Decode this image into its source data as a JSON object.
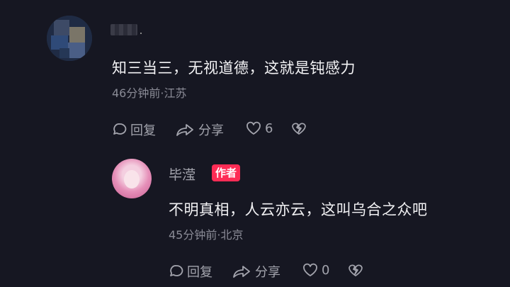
{
  "comment": {
    "text": "知三当三，无视道德，这就是钝感力",
    "meta": "46分钟前·江苏",
    "actions": {
      "reply_label": "回复",
      "share_label": "分享",
      "like_count": "6"
    }
  },
  "reply": {
    "username": "毕滢",
    "author_badge": "作者",
    "text": "不明真相，人云亦云，这叫乌合之众吧",
    "meta": "45分钟前·北京",
    "actions": {
      "reply_label": "回复",
      "share_label": "分享",
      "like_count": "0"
    }
  },
  "colors": {
    "background": "#161722",
    "text_primary": "#f2f2f4",
    "text_secondary": "#8a8b96",
    "badge": "#fe2c55"
  },
  "icons": [
    "reply-icon",
    "share-icon",
    "heart-icon",
    "dislike-icon"
  ]
}
